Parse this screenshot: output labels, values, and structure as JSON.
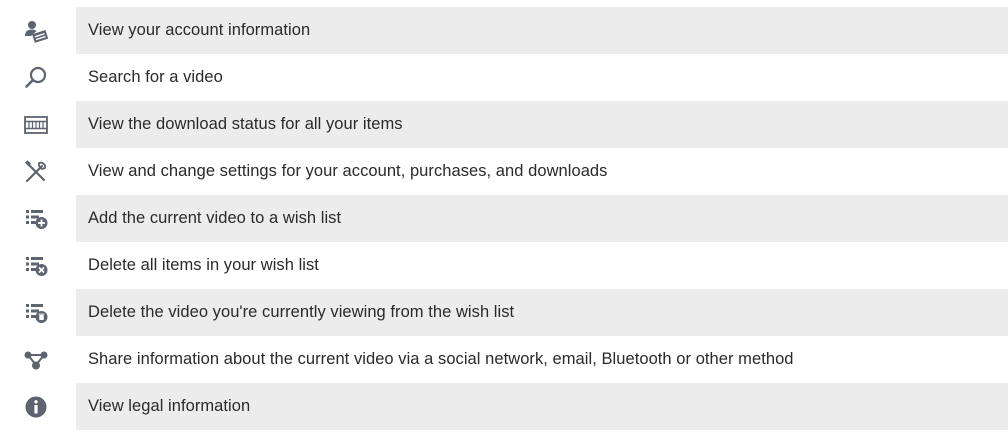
{
  "rows": [
    {
      "icon": "account-info-icon",
      "text": "View your account information",
      "shaded": true
    },
    {
      "icon": "search-icon",
      "text": "Search for a video",
      "shaded": false
    },
    {
      "icon": "download-status-icon",
      "text": "View the download status for all your items",
      "shaded": true
    },
    {
      "icon": "settings-tools-icon",
      "text": "View and change settings for your account, purchases, and downloads",
      "shaded": false
    },
    {
      "icon": "add-to-wishlist-icon",
      "text": "Add the current video to a wish list",
      "shaded": true
    },
    {
      "icon": "delete-all-wishlist-icon",
      "text": "Delete all items in your wish list",
      "shaded": false
    },
    {
      "icon": "delete-from-wishlist-icon",
      "text": "Delete the video you're currently viewing from the wish list",
      "shaded": true
    },
    {
      "icon": "share-icon",
      "text": "Share information about the current video via a social network, email, Bluetooth or other method",
      "shaded": false
    },
    {
      "icon": "legal-info-icon",
      "text": "View legal information",
      "shaded": true
    }
  ],
  "colors": {
    "shade": "#ececec",
    "icon": "#5d6470",
    "text": "#2a2a2a"
  }
}
